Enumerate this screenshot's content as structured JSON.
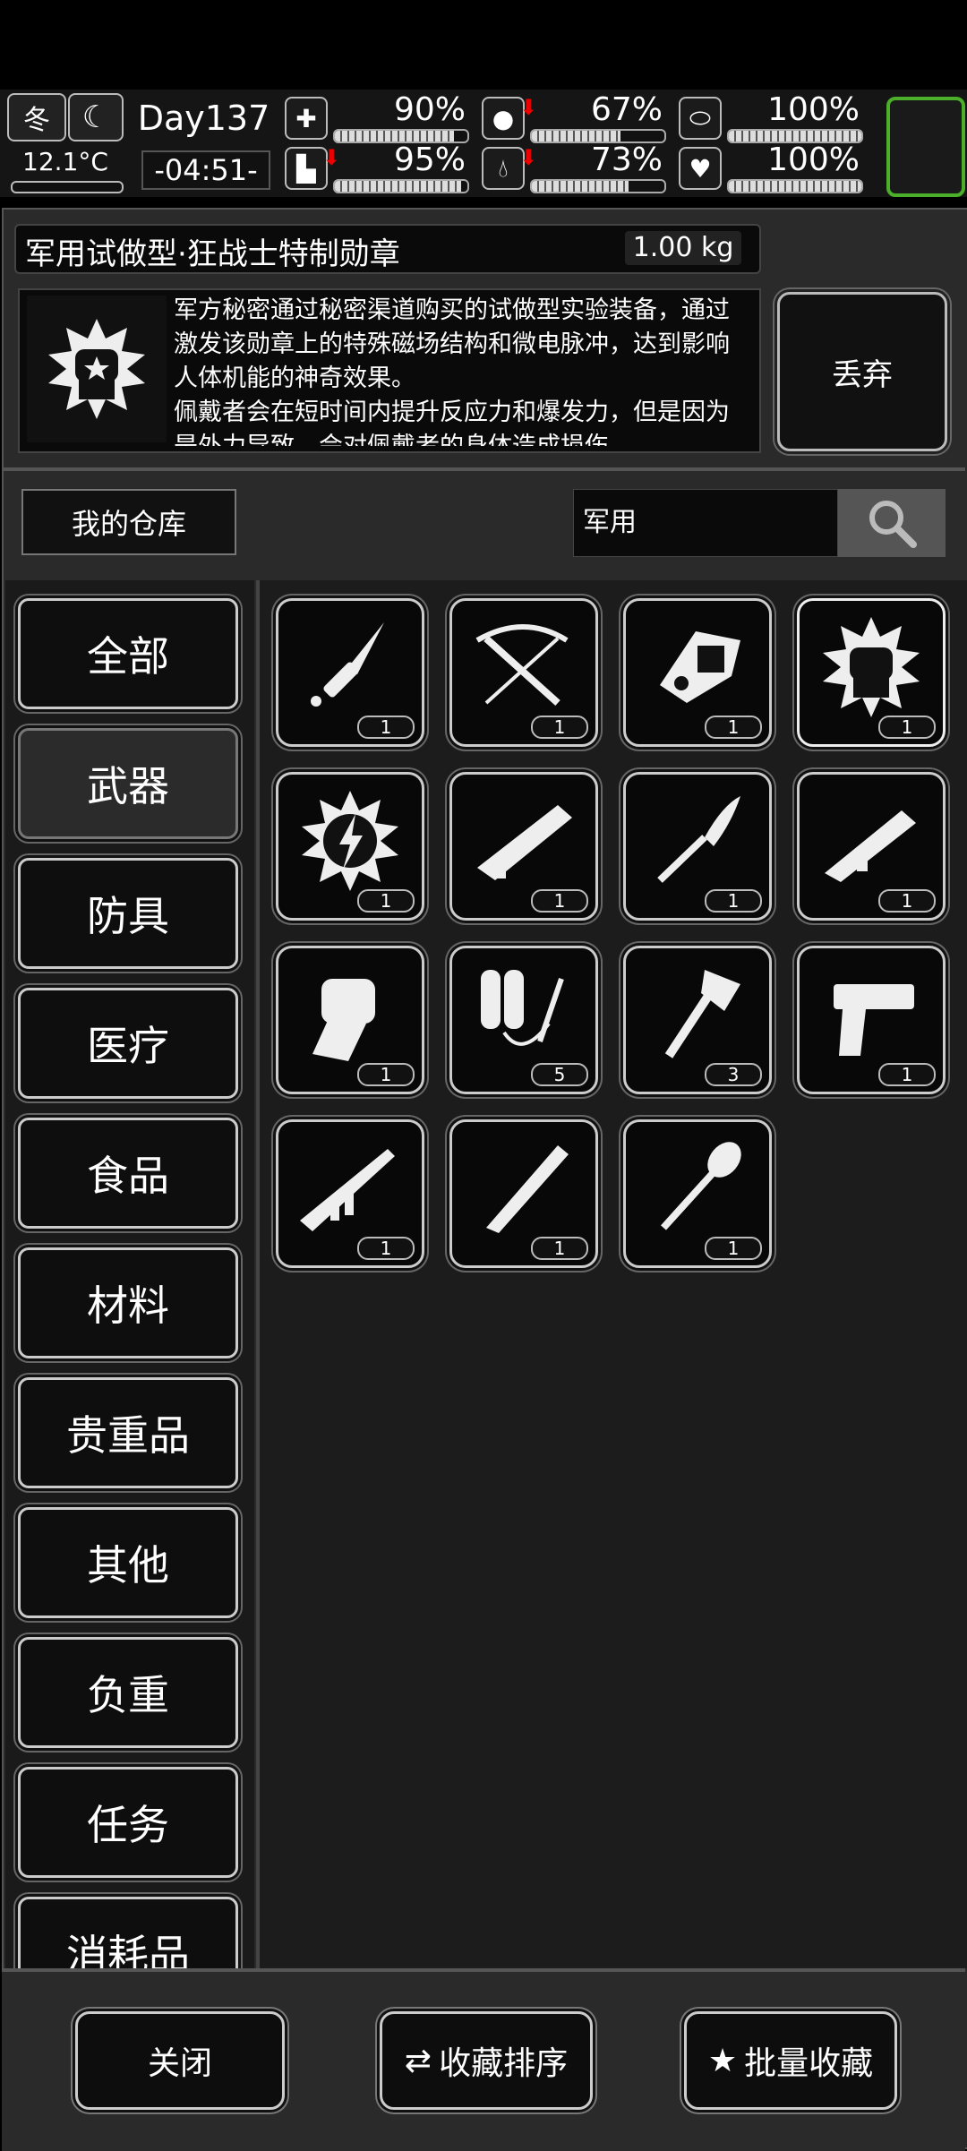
{
  "hud": {
    "season": "冬",
    "temperature": "12.1°C",
    "day": "Day137",
    "time": "-04:51-",
    "stats": [
      {
        "icon": "medkit-icon",
        "value": "90%",
        "fill": 0.9,
        "down": false
      },
      {
        "icon": "stomach-icon",
        "value": "67%",
        "fill": 0.67,
        "down": true
      },
      {
        "icon": "pill-icon",
        "value": "100%",
        "fill": 1.0,
        "down": false
      },
      {
        "icon": "boot-icon",
        "value": "95%",
        "fill": 0.95,
        "down": true
      },
      {
        "icon": "water-drop-icon",
        "value": "73%",
        "fill": 0.73,
        "down": true
      },
      {
        "icon": "heart-icon",
        "value": "100%",
        "fill": 1.0,
        "down": false
      }
    ],
    "accent": "#4caf2a"
  },
  "item": {
    "name": "军用试做型·狂战士特制勋章",
    "weight": "1.00 kg",
    "description": "军方秘密通过秘密渠道购买的试做型实验装备，通过激发该勋章上的特殊磁场结构和微电脉冲，达到影响人体机能的神奇效果。\n佩戴者会在短时间内提升反应力和爆发力，但是因为是外力导致，会对佩戴者的身体造成损伤",
    "discard_label": "丢弃"
  },
  "warehouse": {
    "label": "我的仓库",
    "search_value": "军用"
  },
  "categories": [
    "全部",
    "武器",
    "防具",
    "医疗",
    "食品",
    "材料",
    "贵重品",
    "其他",
    "负重",
    "任务",
    "消耗品"
  ],
  "active_category": "武器",
  "items": [
    {
      "icon": "combat-knife-icon",
      "count": "1"
    },
    {
      "icon": "crossbow-icon",
      "count": "1"
    },
    {
      "icon": "energy-gauntlet-icon",
      "count": "1"
    },
    {
      "icon": "berserker-medal-icon",
      "count": "1",
      "selected": true
    },
    {
      "icon": "lightning-emblem-icon",
      "count": "1"
    },
    {
      "icon": "heavy-rifle-icon",
      "count": "1"
    },
    {
      "icon": "blade-spear-icon",
      "count": "1"
    },
    {
      "icon": "grenade-launcher-icon",
      "count": "1"
    },
    {
      "icon": "power-fist-icon",
      "count": "1"
    },
    {
      "icon": "flamethrower-icon",
      "count": "5"
    },
    {
      "icon": "axe-icon",
      "count": "3"
    },
    {
      "icon": "desert-eagle-icon",
      "count": "1"
    },
    {
      "icon": "assault-rifle-icon",
      "count": "1"
    },
    {
      "icon": "machete-icon",
      "count": "1"
    },
    {
      "icon": "shovel-icon",
      "count": "1"
    }
  ],
  "footer": {
    "close": "关闭",
    "sort": "收藏排序",
    "batch": "批量收藏"
  }
}
